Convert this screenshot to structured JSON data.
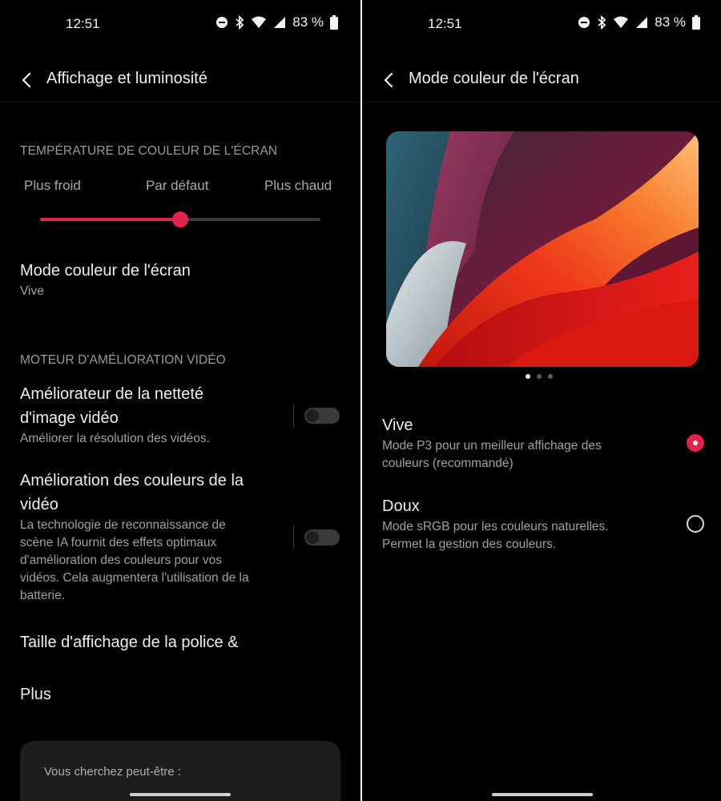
{
  "status": {
    "time": "12:51",
    "battery": "83 %"
  },
  "left": {
    "title": "Affichage et luminosité",
    "color_temp_header": "TEMPÉRATURE DE COULEUR DE L'ÉCRAN",
    "slider_labels": [
      "Plus froid",
      "Par défaut",
      "Plus chaud"
    ],
    "slider_value_fraction": 0.5,
    "color_mode": {
      "title": "Mode couleur de l'écran",
      "value": "Vive"
    },
    "video_header": "MOTEUR D'AMÉLIORATION VIDÉO",
    "sharpness": {
      "title_line1": "Améliorateur de la netteté",
      "title_line2": "d'image vidéo",
      "subtitle": "Améliorer la résolution des vidéos.",
      "enabled": false
    },
    "color_enhance": {
      "title_line1": "Amélioration des couleurs de la",
      "title_line2": "vidéo",
      "desc_lines": [
        "La technologie de reconnaissance de",
        "scène IA fournit des effets optimaux",
        "d'amélioration des couleurs pour vos",
        "vidéos. Cela augmentera l'utilisation de la",
        "batterie."
      ],
      "enabled": false
    },
    "font_size": "Taille d'affichage de la police &",
    "more": "Plus",
    "suggest_label": "Vous cherchez peut-être :"
  },
  "right": {
    "title": "Mode couleur de l'écran",
    "carousel_pages": 3,
    "carousel_active": 1,
    "options": [
      {
        "title": "Vive",
        "desc_line1": "Mode P3 pour un meilleur affichage des",
        "desc_line2": "couleurs (recommandé)",
        "selected": true
      },
      {
        "title": "Doux",
        "desc_line1": "Mode sRGB pour les couleurs naturelles.",
        "desc_line2": "Permet la gestion des couleurs.",
        "selected": false
      }
    ]
  },
  "colors": {
    "accent": "#e0244d",
    "background": "#000000"
  },
  "icons": [
    "dnd-icon",
    "bluetooth-icon",
    "wifi-icon",
    "signal-icon",
    "battery-icon",
    "back-arrow-icon"
  ]
}
